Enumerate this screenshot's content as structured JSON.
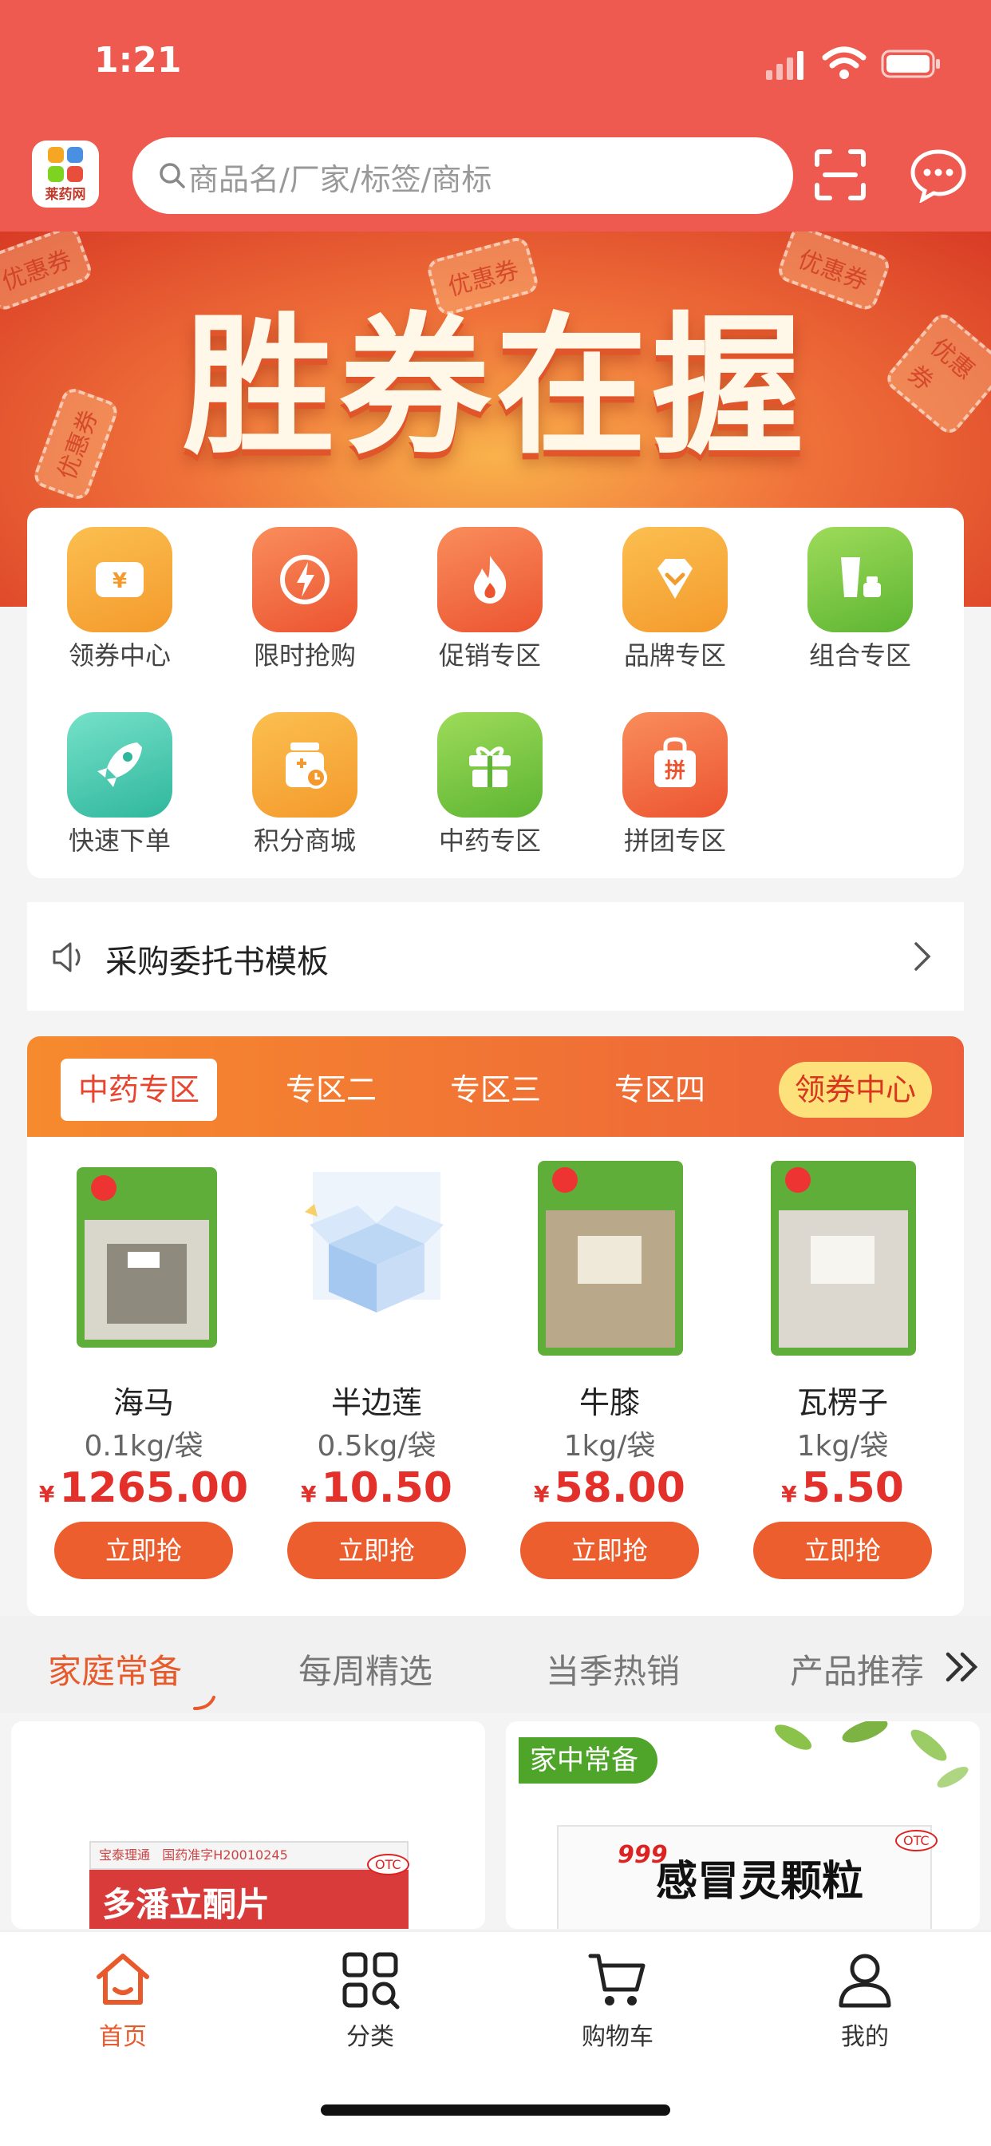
{
  "status_bar": {
    "time": "1:21"
  },
  "header": {
    "logo_text": "莱药网",
    "search_placeholder": "商品名/厂家/标签/商标"
  },
  "banner": {
    "title": "胜券在握",
    "coupon_text": "优惠券"
  },
  "quick_menu": [
    {
      "label": "领券中心",
      "icon": "yen-ticket-icon"
    },
    {
      "label": "限时抢购",
      "icon": "lightning-icon"
    },
    {
      "label": "促销专区",
      "icon": "flame-icon"
    },
    {
      "label": "品牌专区",
      "icon": "gem-icon"
    },
    {
      "label": "组合专区",
      "icon": "cosmetics-icon"
    },
    {
      "label": "快速下单",
      "icon": "rocket-icon"
    },
    {
      "label": "积分商城",
      "icon": "points-jar-icon"
    },
    {
      "label": "中药专区",
      "icon": "gift-icon"
    },
    {
      "label": "拼团专区",
      "icon": "group-bag-icon"
    }
  ],
  "notice": {
    "text": "采购委托书模板"
  },
  "zone": {
    "tabs": [
      "中药专区",
      "专区二",
      "专区三",
      "专区四"
    ],
    "coupon_pill": "领券中心",
    "products": [
      {
        "name": "海马",
        "spec": "0.1kg/袋",
        "price": "1265.00",
        "currency": "¥",
        "button": "立即抢"
      },
      {
        "name": "半边莲",
        "spec": "0.5kg/袋",
        "price": "10.50",
        "currency": "¥",
        "button": "立即抢"
      },
      {
        "name": "牛膝",
        "spec": "1kg/袋",
        "price": "58.00",
        "currency": "¥",
        "button": "立即抢"
      },
      {
        "name": "瓦楞子",
        "spec": "1kg/袋",
        "price": "5.50",
        "currency": "¥",
        "button": "立即抢"
      }
    ]
  },
  "category_tabs": [
    "家庭常备",
    "每周精选",
    "当季热销",
    "产品推荐"
  ],
  "cards": [
    {
      "product_text": "多潘立酮片",
      "brand": "宝泰理通",
      "approval": "国药准字H20010245",
      "badge": "OTC"
    },
    {
      "label": "家中常备",
      "brand": "999",
      "product_text": "感冒灵颗粒",
      "badge": "OTC"
    }
  ],
  "bottom_nav": [
    {
      "label": "首页",
      "active": true
    },
    {
      "label": "分类",
      "active": false
    },
    {
      "label": "购物车",
      "active": false
    },
    {
      "label": "我的",
      "active": false
    }
  ],
  "colors": {
    "primary": "#ee5a4f",
    "accent": "#ec5e2e",
    "price": "#e3302a"
  }
}
